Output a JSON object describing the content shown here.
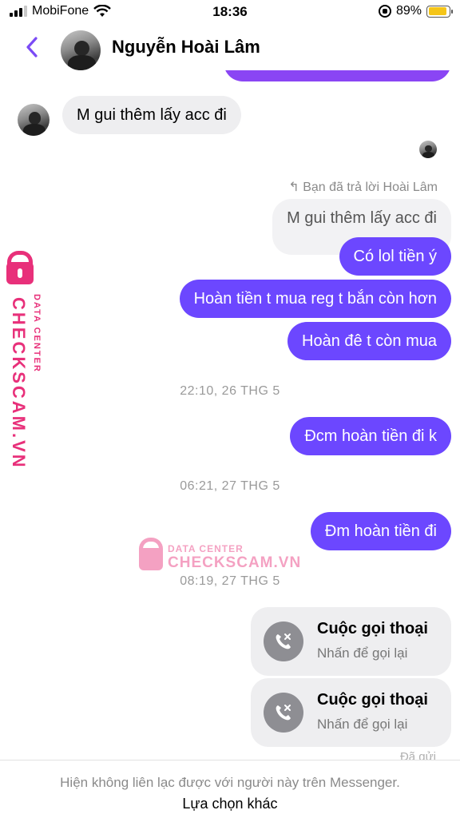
{
  "status_bar": {
    "carrier": "MobiFone",
    "time": "18:36",
    "battery": "89%",
    "battery_level": 0.89
  },
  "header": {
    "contact_name": "Nguyễn Hoài Lâm"
  },
  "messages": {
    "incoming_1": "M gui thêm lấy acc đi",
    "reply_note": "Bạn đã trả lời Hoài Lâm",
    "quoted": "M gui thêm lấy acc đi",
    "out_1": "Có lol tiền ý",
    "out_2": "Hoàn tiền t mua reg t bắn còn hơn",
    "out_3": "Hoàn đê t còn mua",
    "time_1": "22:10, 26 THG 5",
    "out_4": "Đcm hoàn tiền đi k",
    "time_2": "06:21, 27 THG 5",
    "out_5": "Đm hoàn tiền đi",
    "time_3": "08:19, 27 THG 5",
    "calls": [
      {
        "title": "Cuộc gọi thoại",
        "subtitle": "Nhấn để gọi lại"
      },
      {
        "title": "Cuộc gọi thoại",
        "subtitle": "Nhấn để gọi lại"
      }
    ],
    "sent": "Đã gửi"
  },
  "footer": {
    "note": "Hiện không liên lạc được với người này trên Messenger.",
    "link": "Lựa chọn khác"
  },
  "watermark": {
    "brand": "CHECKSCAM.VN",
    "tagline": "DATA CENTER"
  },
  "colors": {
    "accent": "#6c47ff",
    "back_icon": "#7b4bf5",
    "watermark": "#e8307a"
  }
}
